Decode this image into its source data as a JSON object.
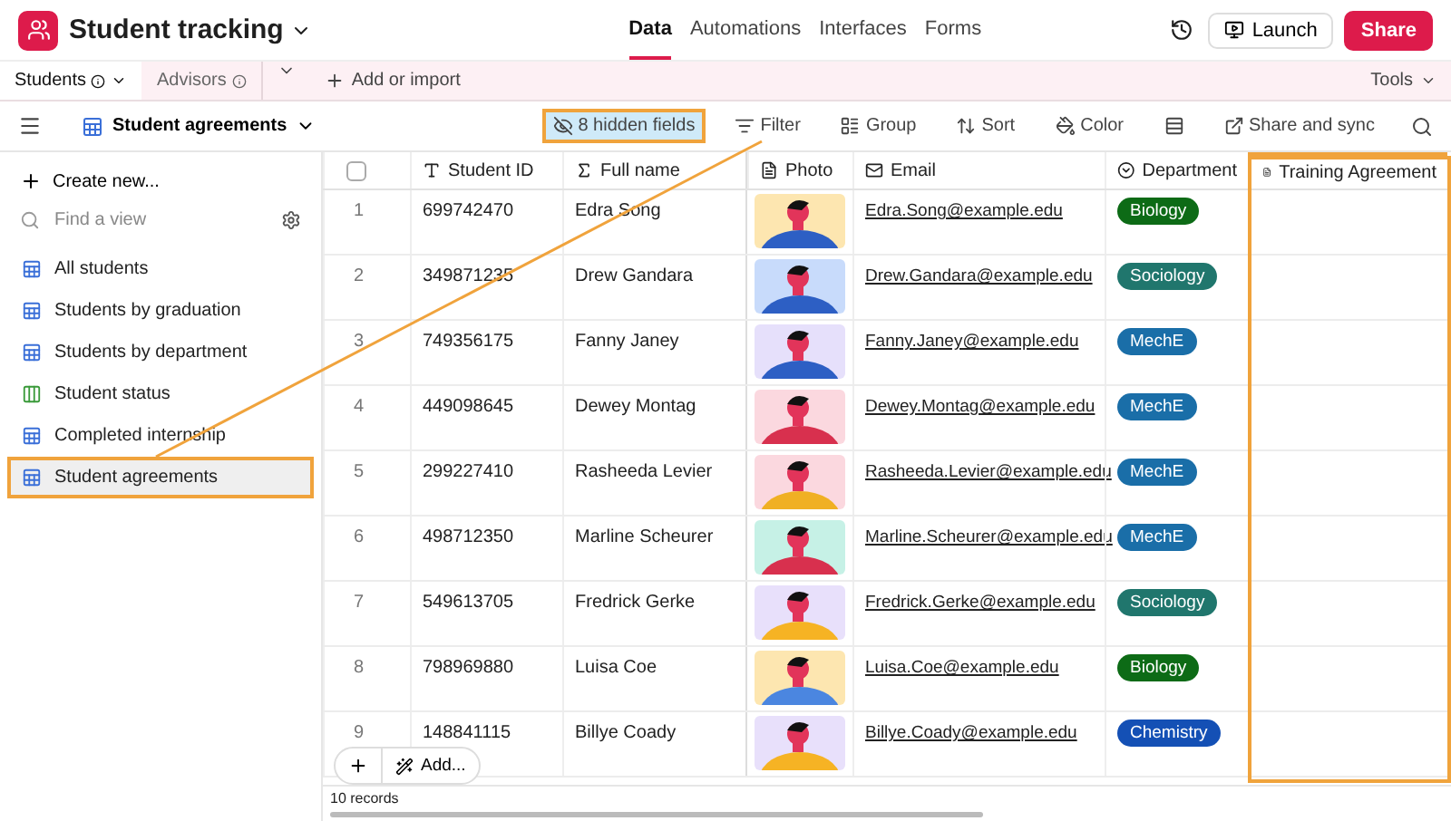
{
  "app": {
    "title": "Student tracking"
  },
  "nav": [
    {
      "label": "Data",
      "selected": true
    },
    {
      "label": "Automations",
      "selected": false
    },
    {
      "label": "Interfaces",
      "selected": false
    },
    {
      "label": "Forms",
      "selected": false
    }
  ],
  "actions": {
    "launch": "Launch",
    "share": "Share"
  },
  "tables": [
    {
      "label": "Students",
      "selected": true
    },
    {
      "label": "Advisors",
      "selected": false
    }
  ],
  "add_or_import": "Add or import",
  "tools": "Tools",
  "view": {
    "name": "Student agreements"
  },
  "toolbar": [
    {
      "kind": "hidden",
      "label": "8 hidden fields",
      "highlighted": true
    },
    {
      "kind": "filter",
      "label": "Filter",
      "highlighted": false
    },
    {
      "kind": "group",
      "label": "Group",
      "highlighted": false
    },
    {
      "kind": "sort",
      "label": "Sort",
      "highlighted": false
    },
    {
      "kind": "color",
      "label": "Color",
      "highlighted": false
    },
    {
      "kind": "height",
      "highlighted": false
    },
    {
      "kind": "share",
      "label": "Share and sync",
      "highlighted": false
    }
  ],
  "sidebar": {
    "create": "Create new...",
    "search_placeholder": "Find a view",
    "items": [
      {
        "label": "All students",
        "kind": "grid",
        "selected": false
      },
      {
        "label": "Students by graduation",
        "kind": "grid",
        "selected": false
      },
      {
        "label": "Students by department",
        "kind": "grid",
        "selected": false
      },
      {
        "label": "Student status",
        "kind": "kanban",
        "selected": false
      },
      {
        "label": "Completed internship",
        "kind": "grid",
        "selected": false
      },
      {
        "label": "Student agreements",
        "kind": "grid",
        "selected": true
      }
    ]
  },
  "table": {
    "select_all": {
      "checked": false
    },
    "columns": [
      {
        "label": "Student ID",
        "kind": "text",
        "highlighted": false
      },
      {
        "label": "Full name",
        "kind": "formula",
        "highlighted": false
      },
      {
        "label": "Photo",
        "kind": "file",
        "highlighted": false
      },
      {
        "label": "Email",
        "kind": "email",
        "highlighted": false
      },
      {
        "label": "Department",
        "kind": "select",
        "highlighted": false
      },
      {
        "label": "Training Agreement",
        "kind": "file",
        "highlighted": true
      }
    ],
    "rows": [
      {
        "n": "1",
        "id": "699742470",
        "name": "Edra Song",
        "email": "Edra.Song@example.edu",
        "dept": {
          "label": "Biology",
          "color": "#0d6b16"
        }
      },
      {
        "n": "2",
        "id": "349871235",
        "name": "Drew Gandara",
        "email": "Drew.Gandara@example.edu",
        "dept": {
          "label": "Sociology",
          "color": "#20766d"
        }
      },
      {
        "n": "3",
        "id": "749356175",
        "name": "Fanny Janey",
        "email": "Fanny.Janey@example.edu",
        "dept": {
          "label": "MechE",
          "color": "#1a6ea8"
        }
      },
      {
        "n": "4",
        "id": "449098645",
        "name": "Dewey Montag",
        "email": "Dewey.Montag@example.edu",
        "dept": {
          "label": "MechE",
          "color": "#1a6ea8"
        }
      },
      {
        "n": "5",
        "id": "299227410",
        "name": "Rasheeda Levier",
        "email": "Rasheeda.Levier@example.edu",
        "dept": {
          "label": "MechE",
          "color": "#1a6ea8"
        }
      },
      {
        "n": "6",
        "id": "498712350",
        "name": "Marline Scheurer",
        "email": "Marline.Scheurer@example.edu",
        "dept": {
          "label": "MechE",
          "color": "#1a6ea8"
        }
      },
      {
        "n": "7",
        "id": "549613705",
        "name": "Fredrick Gerke",
        "email": "Fredrick.Gerke@example.edu",
        "dept": {
          "label": "Sociology",
          "color": "#20766d"
        }
      },
      {
        "n": "8",
        "id": "798969880",
        "name": "Luisa Coe",
        "email": "Luisa.Coe@example.edu",
        "dept": {
          "label": "Biology",
          "color": "#0d6b16"
        }
      },
      {
        "n": "9",
        "id": "148841115",
        "name": "Billye Coady",
        "email": "Billye.Coady@example.edu",
        "dept": {
          "label": "Chemistry",
          "color": "#1450b5"
        }
      }
    ]
  },
  "add_button": "Add...",
  "record_count": "10 records"
}
